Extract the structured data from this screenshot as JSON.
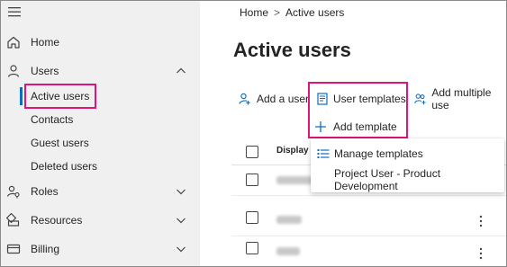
{
  "sidebar": {
    "items": [
      {
        "label": "Home",
        "icon": "home-icon"
      },
      {
        "label": "Users",
        "icon": "user-icon",
        "expanded": true
      },
      {
        "label": "Roles",
        "icon": "roles-icon"
      },
      {
        "label": "Resources",
        "icon": "resources-icon"
      },
      {
        "label": "Billing",
        "icon": "billing-icon"
      }
    ],
    "users_sub": [
      "Active users",
      "Contacts",
      "Guest users",
      "Deleted users"
    ]
  },
  "breadcrumb": {
    "home": "Home",
    "separator": ">",
    "current": "Active users"
  },
  "page_title": "Active users",
  "toolbar": {
    "add_user": "Add a user",
    "user_templates": "User templates",
    "add_multiple": "Add multiple use"
  },
  "table": {
    "col_display": "Display n"
  },
  "templates_menu": {
    "add_template": "Add template",
    "manage_templates": "Manage templates",
    "project_user": "Project User - Product Development"
  },
  "colors": {
    "accent": "#0f6cbd",
    "highlight": "#e0157a",
    "sidebar_bg": "#f0f0f0"
  }
}
